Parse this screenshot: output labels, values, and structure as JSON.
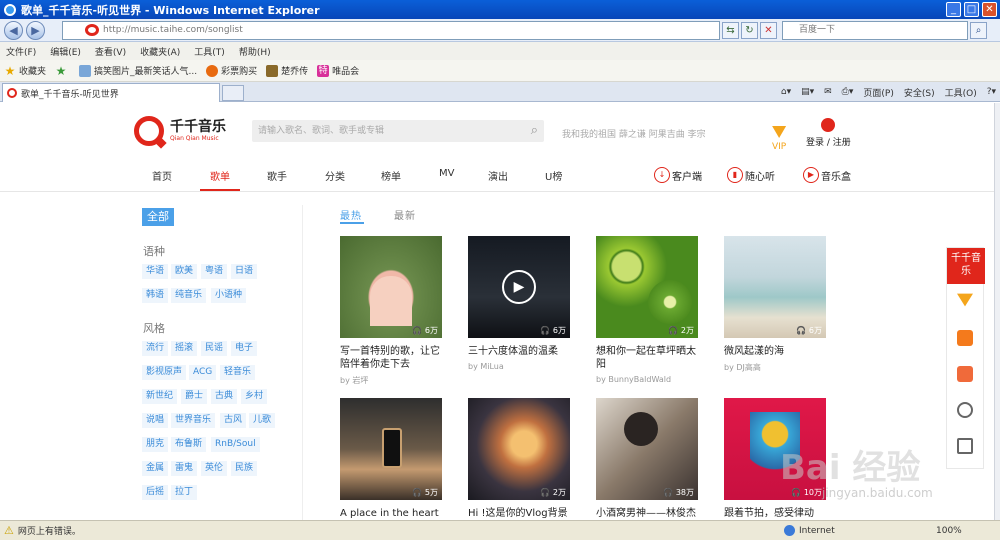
{
  "window": {
    "title": "歌单_千千音乐-听见世界 - Windows Internet Explorer"
  },
  "address": {
    "url": "http://music.taihe.com/songlist"
  },
  "search_box": {
    "placeholder": "百度一下"
  },
  "menu": [
    "文件(F)",
    "编辑(E)",
    "查看(V)",
    "收藏夹(A)",
    "工具(T)",
    "帮助(H)"
  ],
  "favorites": {
    "label": "收藏夹",
    "items": [
      "搞笑图片_最新笑话人气...",
      "彩票购买",
      "楚乔传",
      "唯品会"
    ]
  },
  "tab": {
    "title": "歌单_千千音乐-听见世界"
  },
  "commands": [
    "页面(P)",
    "安全(S)",
    "工具(O)"
  ],
  "site": {
    "logo": {
      "name": "千千音乐",
      "sub": "Qian Qian Music"
    },
    "search_placeholder": "请输入歌名、歌词、歌手或专辑",
    "hot_searches": "我和我的祖国  薛之谦  阿果吉曲  李宗",
    "vip": "VIP",
    "login": "登录 / 注册",
    "nav": [
      "首页",
      "歌单",
      "歌手",
      "分类",
      "榜单",
      "MV",
      "演出",
      "U榜"
    ],
    "active_nav": "歌单",
    "right_nav": [
      "客户端",
      "随心听",
      "音乐盒"
    ]
  },
  "sidebar": {
    "all": "全部",
    "groups": [
      {
        "title": "语种",
        "tags": [
          "华语",
          "欧美",
          "粤语",
          "日语",
          "韩语",
          "纯音乐",
          "小语种"
        ]
      },
      {
        "title": "风格",
        "tags": [
          "流行",
          "摇滚",
          "民谣",
          "电子",
          "影视原声",
          "ACG",
          "轻音乐",
          "新世纪",
          "爵士",
          "古典",
          "乡村",
          "说唱",
          "世界音乐",
          "古风",
          "儿歌",
          "朋克",
          "布鲁斯",
          "RnB/Soul",
          "金属",
          "雷鬼",
          "英伦",
          "民族",
          "后摇",
          "拉丁"
        ]
      }
    ]
  },
  "sort_tabs": [
    "最热",
    "最新"
  ],
  "playlists": [
    {
      "title": "写一首特别的歌，让它陪伴着你走下去",
      "by": "by 岩坪",
      "plays": "6万"
    },
    {
      "title": "三十六度体温的温柔",
      "by": "by MiLua",
      "plays": "6万"
    },
    {
      "title": "想和你一起在草坪晒太阳",
      "by": "by BunnyBaldWald",
      "plays": "2万"
    },
    {
      "title": "微风起漾的海",
      "by": "by DJ高高",
      "plays": "6万"
    },
    {
      "title": "A place in the heart",
      "by": "",
      "plays": "5万"
    },
    {
      "title": "Hi !这是你的Vlog背景",
      "by": "",
      "plays": "2万"
    },
    {
      "title": "小酒窝男神——林俊杰",
      "by": "",
      "plays": "38万"
    },
    {
      "title": "跟着节拍，感受律动",
      "by": "",
      "plays": "10万"
    }
  ],
  "float_bar": {
    "top": "千千音乐"
  },
  "watermark": {
    "text": "Bai 经验",
    "url": "jingyan.baidu.com"
  },
  "status": {
    "text": "网页上有错误。",
    "zone": "Internet",
    "zoom": "100%"
  }
}
